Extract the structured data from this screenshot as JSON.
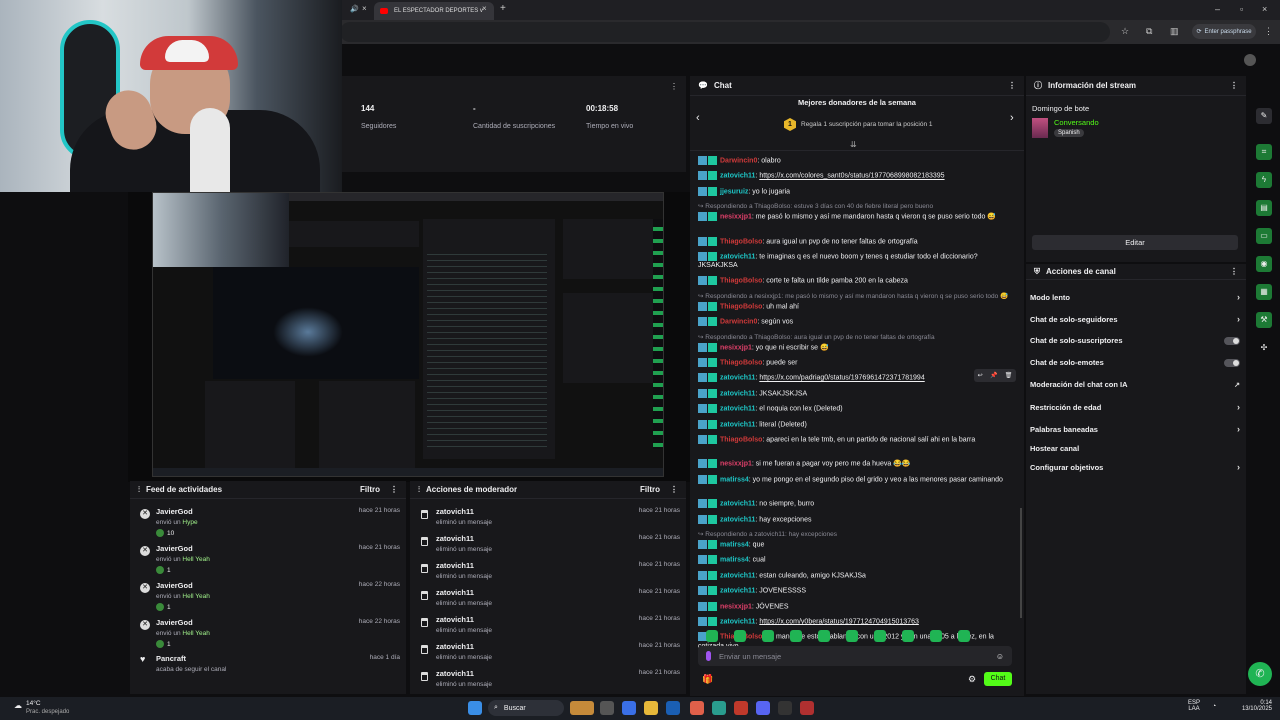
{
  "browser": {
    "tab_title": "EL ESPECTADOR DEPORTES v",
    "passphrase_label": "Enter passphrase"
  },
  "stats": [
    {
      "value": "144",
      "label": "Seguidores"
    },
    {
      "value": "-",
      "label": "Cantidad de suscripciones"
    },
    {
      "value": "00:18:58",
      "label": "Tiempo en vivo"
    }
  ],
  "activity_feed": {
    "title": "Feed de actividades",
    "filter": "Filtro",
    "items": [
      {
        "name": "JavierGod",
        "action": "envió un",
        "item": "Hype",
        "count": "10",
        "time": "hace 21 horas"
      },
      {
        "name": "JavierGod",
        "action": "envió un",
        "item": "Hell Yeah",
        "count": "1",
        "time": "hace 21 horas"
      },
      {
        "name": "JavierGod",
        "action": "envió un",
        "item": "Hell Yeah",
        "count": "1",
        "time": "hace 22 horas"
      },
      {
        "name": "JavierGod",
        "action": "envió un",
        "item": "Hell Yeah",
        "count": "1",
        "time": "hace 22 horas"
      },
      {
        "name": "Pancraft",
        "action": "acaba de seguir el canal",
        "item": "",
        "count": "",
        "time": "hace 1 día"
      }
    ]
  },
  "mod_actions": {
    "title": "Acciones de moderador",
    "filter": "Filtro",
    "items": [
      {
        "name": "zatovich11",
        "desc": "eliminó un mensaje",
        "time": "hace 21 horas"
      },
      {
        "name": "zatovich11",
        "desc": "eliminó un mensaje",
        "time": "hace 21 horas"
      },
      {
        "name": "zatovich11",
        "desc": "eliminó un mensaje",
        "time": "hace 21 horas"
      },
      {
        "name": "zatovich11",
        "desc": "eliminó un mensaje",
        "time": "hace 21 horas"
      },
      {
        "name": "zatovich11",
        "desc": "eliminó un mensaje",
        "time": "hace 21 horas"
      },
      {
        "name": "zatovich11",
        "desc": "eliminó un mensaje",
        "time": "hace 21 horas"
      },
      {
        "name": "zatovich11",
        "desc": "eliminó un mensaje",
        "time": "hace 21 horas"
      }
    ]
  },
  "chat": {
    "title": "Chat",
    "donors_title": "Mejores donadores de la semana",
    "donors_rank": "1",
    "donors_sub": "Regala 1 suscripción para tomar la posición 1",
    "input_placeholder": "Enviar un mensaje",
    "send_label": "Chat",
    "messages": [
      {
        "user": "Darwincin0",
        "color": "red",
        "text": ": olabro",
        "link": "",
        "reply": ""
      },
      {
        "user": "zatovich11",
        "color": "cyan",
        "text": ": ",
        "link": "https://x.com/colores_sant0s/status/1977068998082183395",
        "reply": ""
      },
      {
        "user": "jjesuruiz",
        "color": "cyan",
        "text": ": yo lo jugaria",
        "link": "",
        "reply": ""
      },
      {
        "user": "nesixxjp1",
        "color": "pink",
        "text": ": me pasó lo mismo y así me mandaron hasta q vieron q se puso serio todo 😅",
        "link": "",
        "reply": "Respondiendo a ThiagoBolso: estuve 3 días con 40 de fiebre literal pero bueno"
      },
      {
        "user": "ThiagoBolso",
        "color": "red",
        "text": ": aura igual un pvp de no tener faltas de ortografía",
        "link": "",
        "reply": ""
      },
      {
        "user": "zatovich11",
        "color": "cyan",
        "text": ": te imaginas q es el nuevo boom y tenes q estudiar todo el diccionario? JKSAKJKSA",
        "link": "",
        "reply": ""
      },
      {
        "user": "ThiagoBolso",
        "color": "red",
        "text": ": corte te falta un tilde pamba 200 en la cabeza",
        "link": "",
        "reply": ""
      },
      {
        "user": "ThiagoBolso",
        "color": "red",
        "text": ": uh mal ahí",
        "link": "",
        "reply": "Respondiendo a nesixxjp1: me pasó lo mismo y así me mandaron hasta q vieron q se puso serio todo 😅"
      },
      {
        "user": "Darwincin0",
        "color": "red",
        "text": ": según vos",
        "link": "",
        "reply": ""
      },
      {
        "user": "nesixxjp1",
        "color": "pink",
        "text": ": yo que ni escribir se 😅",
        "link": "",
        "reply": "Respondiendo a ThiagoBolso: aura igual un pvp de no tener faltas de ortografía"
      },
      {
        "user": "ThiagoBolso",
        "color": "red",
        "text": ": puede ser",
        "link": "",
        "reply": ""
      },
      {
        "user": "zatovich11",
        "color": "cyan",
        "text": ": ",
        "link": "https://x.com/padriag0/status/1976961472371781994",
        "reply": ""
      },
      {
        "user": "zatovich11",
        "color": "cyan",
        "text": ": JKSAKJSKJSA",
        "link": "",
        "reply": ""
      },
      {
        "user": "zatovich11",
        "color": "cyan",
        "text": ": el noquia con lex (Deleted)",
        "link": "",
        "reply": ""
      },
      {
        "user": "zatovich11",
        "color": "cyan",
        "text": ": literal (Deleted)",
        "link": "",
        "reply": ""
      },
      {
        "user": "ThiagoBolso",
        "color": "red",
        "text": ": apareci en la tele tmb, en un partido de nacional salí ahi en la barra",
        "link": "",
        "reply": ""
      },
      {
        "user": "nesixxjp1",
        "color": "pink",
        "text": ": si me fueran a pagar voy pero me da hueva 😂😂",
        "link": "",
        "reply": ""
      },
      {
        "user": "matirss4",
        "color": "cyan",
        "text": ": yo me pongo en el segundo piso del grido y veo a las menores pasar caminando",
        "link": "",
        "reply": ""
      },
      {
        "user": "zatovich11",
        "color": "cyan",
        "text": ": no siempre, burro",
        "link": "",
        "reply": ""
      },
      {
        "user": "zatovich11",
        "color": "cyan",
        "text": ": hay excepciones",
        "link": "",
        "reply": ""
      },
      {
        "user": "matirss4",
        "color": "cyan",
        "text": ": que",
        "link": "",
        "reply": "Respondiendo a zatovich11: hay excepciones"
      },
      {
        "user": "matirss4",
        "color": "cyan",
        "text": ": cual",
        "link": "",
        "reply": ""
      },
      {
        "user": "zatovich11",
        "color": "cyan",
        "text": ": estan culeando, amigo KJSAKJSa",
        "link": "",
        "reply": ""
      },
      {
        "user": "zatovich11",
        "color": "cyan",
        "text": ": JOVENESSSS",
        "link": "",
        "reply": ""
      },
      {
        "user": "nesixxjp1",
        "color": "pink",
        "text": ": JÓVENES",
        "link": "",
        "reply": ""
      },
      {
        "user": "zatovich11",
        "color": "cyan",
        "text": ": ",
        "link": "https://x.com/y0bera/status/1977124704915013763",
        "reply": ""
      },
      {
        "user": "ThiagoBolso",
        "color": "red",
        "text": ": pa mano me estoy hablando con una 2012 y con una 2005 a la vez, en la cotizada vivo",
        "link": "",
        "reply": ""
      }
    ]
  },
  "stream_info": {
    "title": "Información del stream",
    "stream_title": "Domingo de bote",
    "category": "Conversando",
    "language": "Spanish",
    "edit_label": "Editar"
  },
  "channel_actions": {
    "title": "Acciones de canal",
    "items": [
      {
        "label": "Modo lento",
        "control": "arrow"
      },
      {
        "label": "Chat de solo-seguidores",
        "control": "arrow"
      },
      {
        "label": "Chat de solo-suscriptores",
        "control": "toggle"
      },
      {
        "label": "Chat de solo-emotes",
        "control": "toggle"
      },
      {
        "label": "Moderación del chat con IA",
        "control": "ext"
      },
      {
        "label": "Restricción de edad",
        "control": "arrow"
      },
      {
        "label": "Palabras baneadas",
        "control": "arrow"
      },
      {
        "label": "Hostear canal",
        "control": "none"
      },
      {
        "label": "Configurar objetivos",
        "control": "arrow"
      }
    ]
  },
  "taskbar": {
    "weather_temp": "14°C",
    "weather_desc": "Prac. despejado",
    "search": "Buscar",
    "lang": "ESP",
    "lang2": "LAA",
    "time": "0:14",
    "date": "13/10/2025"
  }
}
